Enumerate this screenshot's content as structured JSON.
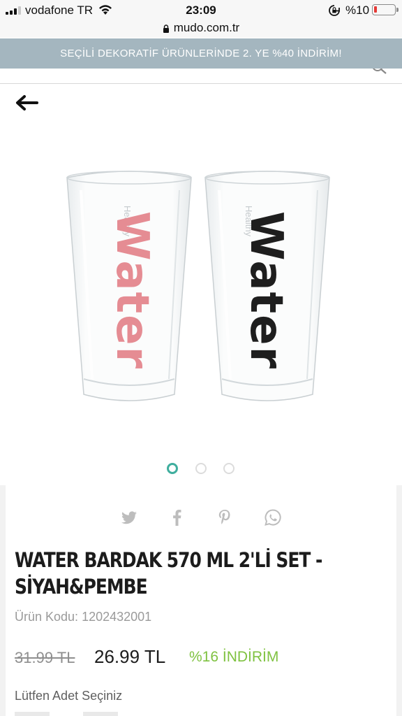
{
  "status_bar": {
    "carrier": "vodafone TR",
    "time": "23:09",
    "battery": "%10"
  },
  "browser": {
    "url": "mudo.com.tr"
  },
  "promo": {
    "text": "SEÇİLİ DEKORATİF ÜRÜNLERİNDE 2. YE %40 İNDİRİM!"
  },
  "gallery": {
    "image_count": 3,
    "active_index": 0,
    "glasses": [
      {
        "word": "Water",
        "small_word": "Healthy",
        "color": "#e58c93"
      },
      {
        "word": "Water",
        "small_word": "Healthy",
        "color": "#1e1e1e"
      }
    ]
  },
  "share": {
    "icons": [
      "twitter-icon",
      "facebook-icon",
      "pinterest-icon",
      "whatsapp-icon"
    ],
    "icon_color": "#bdbdbd"
  },
  "product": {
    "title_line1": "WATER BARDAK 570 ML 2'Lİ SET -",
    "title_line2": "SİYAH&PEMBE",
    "code_label": "Ürün Kodu:",
    "code_value": "1202432001",
    "old_price": "31.99 TL",
    "new_price": "26.99 TL",
    "discount": "%16 İNDİRİM",
    "quantity_label": "Lütfen Adet Seçiniz"
  },
  "colors": {
    "promo_bg": "#a4b6bf",
    "accent_teal": "#3fae9e",
    "discount_green": "#7fc241"
  }
}
